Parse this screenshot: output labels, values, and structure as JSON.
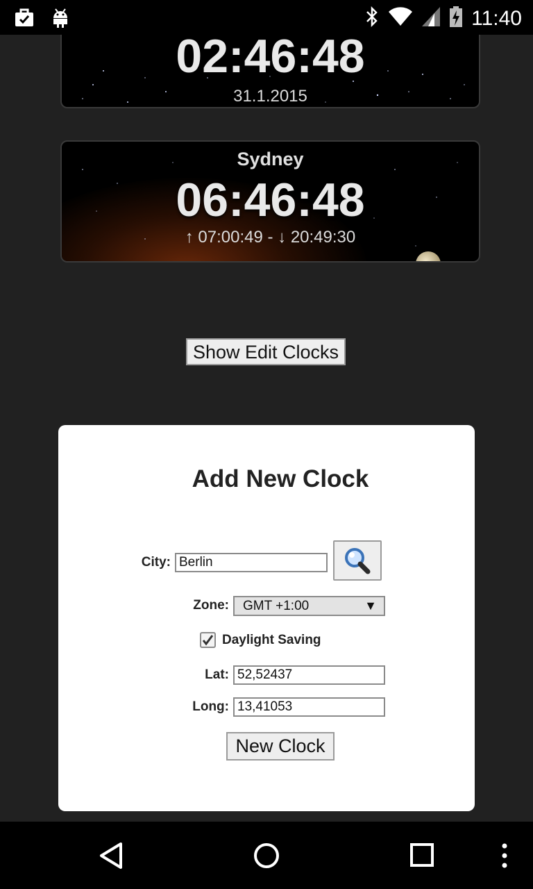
{
  "status_bar": {
    "time": "11:40",
    "icons": [
      "store-icon",
      "android-icon",
      "bluetooth-icon",
      "wifi-icon",
      "signal-icon",
      "battery-charging-icon"
    ]
  },
  "clocks": [
    {
      "time": "02:46:48",
      "date": "31.1.2015"
    },
    {
      "city": "Sydney",
      "time": "06:46:48",
      "sunrise_sunset": "↑ 07:00:49 - ↓ 20:49:30"
    }
  ],
  "show_edit_button": "Show Edit Clocks",
  "add_clock": {
    "title": "Add New Clock",
    "city_label": "City:",
    "city_value": "Berlin",
    "zone_label": "Zone:",
    "zone_value": "GMT +1:00",
    "dst_label": "Daylight Saving",
    "dst_checked": true,
    "lat_label": "Lat:",
    "lat_value": "52,52437",
    "long_label": "Long:",
    "long_value": "13,41053",
    "submit_label": "New Clock"
  },
  "nav_bar": {
    "icons": [
      "back-icon",
      "home-icon",
      "recents-icon",
      "overflow-menu-icon"
    ]
  },
  "colors": {
    "background": "#212121",
    "panel": "#ffffff",
    "clock_text": "#e9e9e9"
  }
}
